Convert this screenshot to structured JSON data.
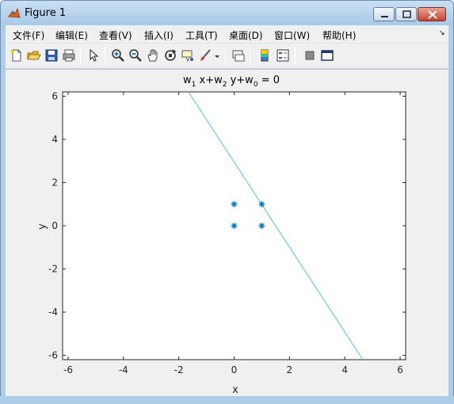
{
  "window": {
    "title": "Figure 1"
  },
  "menu": [
    {
      "label": "文件(F)"
    },
    {
      "label": "编辑(E)"
    },
    {
      "label": "查看(V)"
    },
    {
      "label": "插入(I)"
    },
    {
      "label": "工具(T)"
    },
    {
      "label": "桌面(D)"
    },
    {
      "label": "窗口(W)"
    },
    {
      "label": "帮助(H)"
    }
  ],
  "toolbar_icons": [
    "new-figure-icon",
    "open-file-icon",
    "save-icon",
    "print-icon",
    "pointer-icon",
    "zoom-in-icon",
    "zoom-out-icon",
    "pan-hand-icon",
    "rotate-3d-icon",
    "data-cursor-icon",
    "brush-icon",
    "brush-dropdown-icon",
    "link-plot-icon",
    "colorbar-icon",
    "legend-icon",
    "hide-plot-tools-icon",
    "show-plot-tools-icon"
  ],
  "chart_data": {
    "type": "scatter",
    "title": "w₁ x+w₂ y+w₀ = 0",
    "title_parts": {
      "w1": "w",
      "s1": "1",
      "mid1": " x+w",
      "s2": "2",
      "mid2": " y+w",
      "s0": "0",
      "tail": " = 0"
    },
    "xlabel": "x",
    "ylabel": "y",
    "xlim": [
      -6.2,
      6.2
    ],
    "ylim": [
      -6.2,
      6.2
    ],
    "xticks": [
      -6,
      -4,
      -2,
      0,
      2,
      4,
      6
    ],
    "yticks": [
      -6,
      -4,
      -2,
      0,
      2,
      4,
      6
    ],
    "points": {
      "marker": "*",
      "color": "#0072bd",
      "x": [
        0,
        1,
        0,
        1
      ],
      "y": [
        1,
        1,
        0,
        0
      ]
    },
    "line": {
      "color": "#4dbeee",
      "x": [
        -1.65,
        4.65
      ],
      "y": [
        6.2,
        -6.2
      ]
    },
    "grid": false
  }
}
